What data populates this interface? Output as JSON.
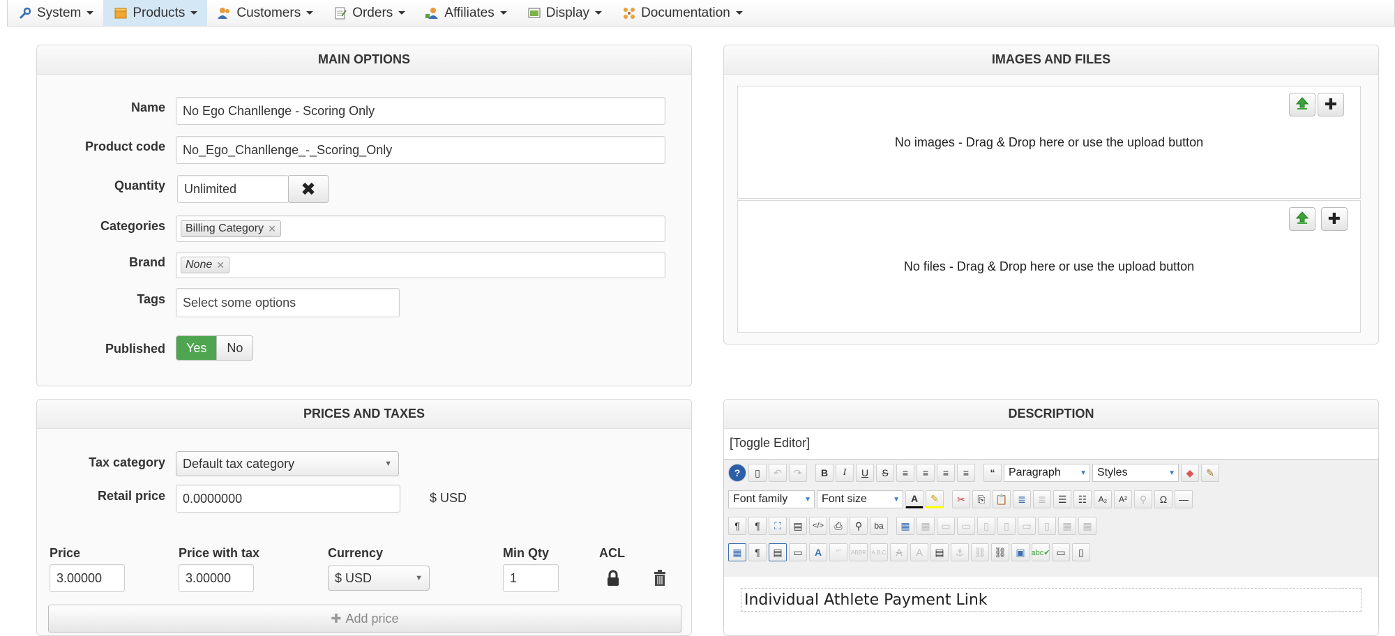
{
  "menu": [
    {
      "label": "System",
      "icon": "wrench-icon"
    },
    {
      "label": "Products",
      "icon": "box-icon",
      "active": true
    },
    {
      "label": "Customers",
      "icon": "users-icon"
    },
    {
      "label": "Orders",
      "icon": "orders-icon"
    },
    {
      "label": "Affiliates",
      "icon": "affiliates-icon"
    },
    {
      "label": "Display",
      "icon": "display-icon"
    },
    {
      "label": "Documentation",
      "icon": "documentation-icon"
    }
  ],
  "main_options": {
    "title": "MAIN OPTIONS",
    "name_label": "Name",
    "name_value": "No Ego Chanllenge - Scoring Only",
    "code_label": "Product code",
    "code_value": "No_Ego_Chanllenge_-_Scoring_Only",
    "quantity_label": "Quantity",
    "quantity_value": "Unlimited",
    "categories_label": "Categories",
    "category_tag": "Billing Category",
    "brand_label": "Brand",
    "brand_tag": "None",
    "tags_label": "Tags",
    "tags_placeholder": "Select some options",
    "published_label": "Published",
    "published_yes": "Yes",
    "published_no": "No"
  },
  "prices": {
    "title": "PRICES AND TAXES",
    "tax_label": "Tax category",
    "tax_value": "Default tax category",
    "retail_label": "Retail price",
    "retail_value": "0.0000000",
    "retail_currency": "$ USD",
    "col_price": "Price",
    "col_price_tax": "Price with tax",
    "col_currency": "Currency",
    "col_min_qty": "Min Qty",
    "col_acl": "ACL",
    "price_value": "3.00000",
    "price_tax_value": "3.00000",
    "currency_value": "$ USD",
    "min_qty_value": "1",
    "add_price": "Add price"
  },
  "images": {
    "title": "IMAGES AND FILES",
    "images_text": "No images - Drag & Drop here or use the upload button",
    "files_text": "No files - Drag & Drop here or use the upload button"
  },
  "description": {
    "title": "DESCRIPTION",
    "toggle": "[Toggle Editor]",
    "format_select": "Paragraph",
    "styles_select": "Styles",
    "font_family": "Font family",
    "font_size": "Font size",
    "content": "Individual Athlete Payment Link"
  },
  "colors": {
    "active_menu": "#d4e7f5",
    "yes_green": "#4fa54f",
    "upload_green": "#3aa33a"
  }
}
